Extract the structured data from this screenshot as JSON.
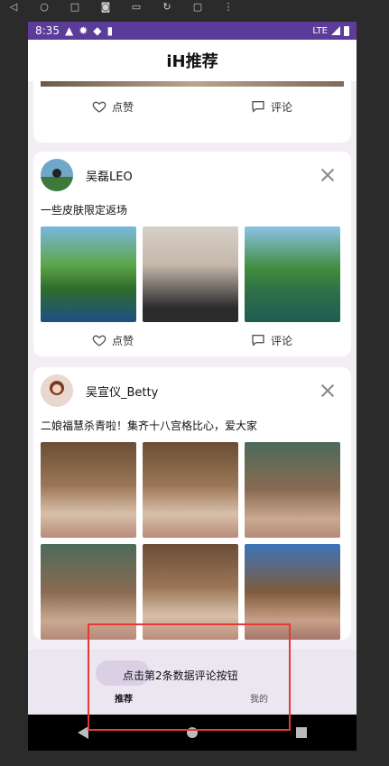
{
  "status_bar": {
    "time": "8:35",
    "network": "LTE"
  },
  "app_bar": {
    "title": "iH推荐"
  },
  "actions": {
    "like_label": "点赞",
    "comment_label": "评论"
  },
  "posts": [
    {
      "username": "吴磊LEO",
      "text": "一些皮肤限定返场",
      "images": [
        "tennis-player-photo",
        "portrait-photo",
        "tennis-court-photo"
      ]
    },
    {
      "username": "吴宣仪_Betty",
      "text": "二娘福慧杀青啦！集齐十八宫格比心，爱大家",
      "images": [
        "drama-set-photo-1",
        "drama-set-photo-2",
        "drama-set-photo-3",
        "drama-set-photo-4",
        "drama-set-photo-5",
        "drama-set-photo-6"
      ]
    }
  ],
  "bottom_nav": {
    "recommend_label": "推荐",
    "mine_label": "我的"
  },
  "toast": {
    "message": "点击第2条数据评论按钮"
  },
  "colors": {
    "status_bar": "#5b3d99",
    "highlight": "#e53935"
  }
}
